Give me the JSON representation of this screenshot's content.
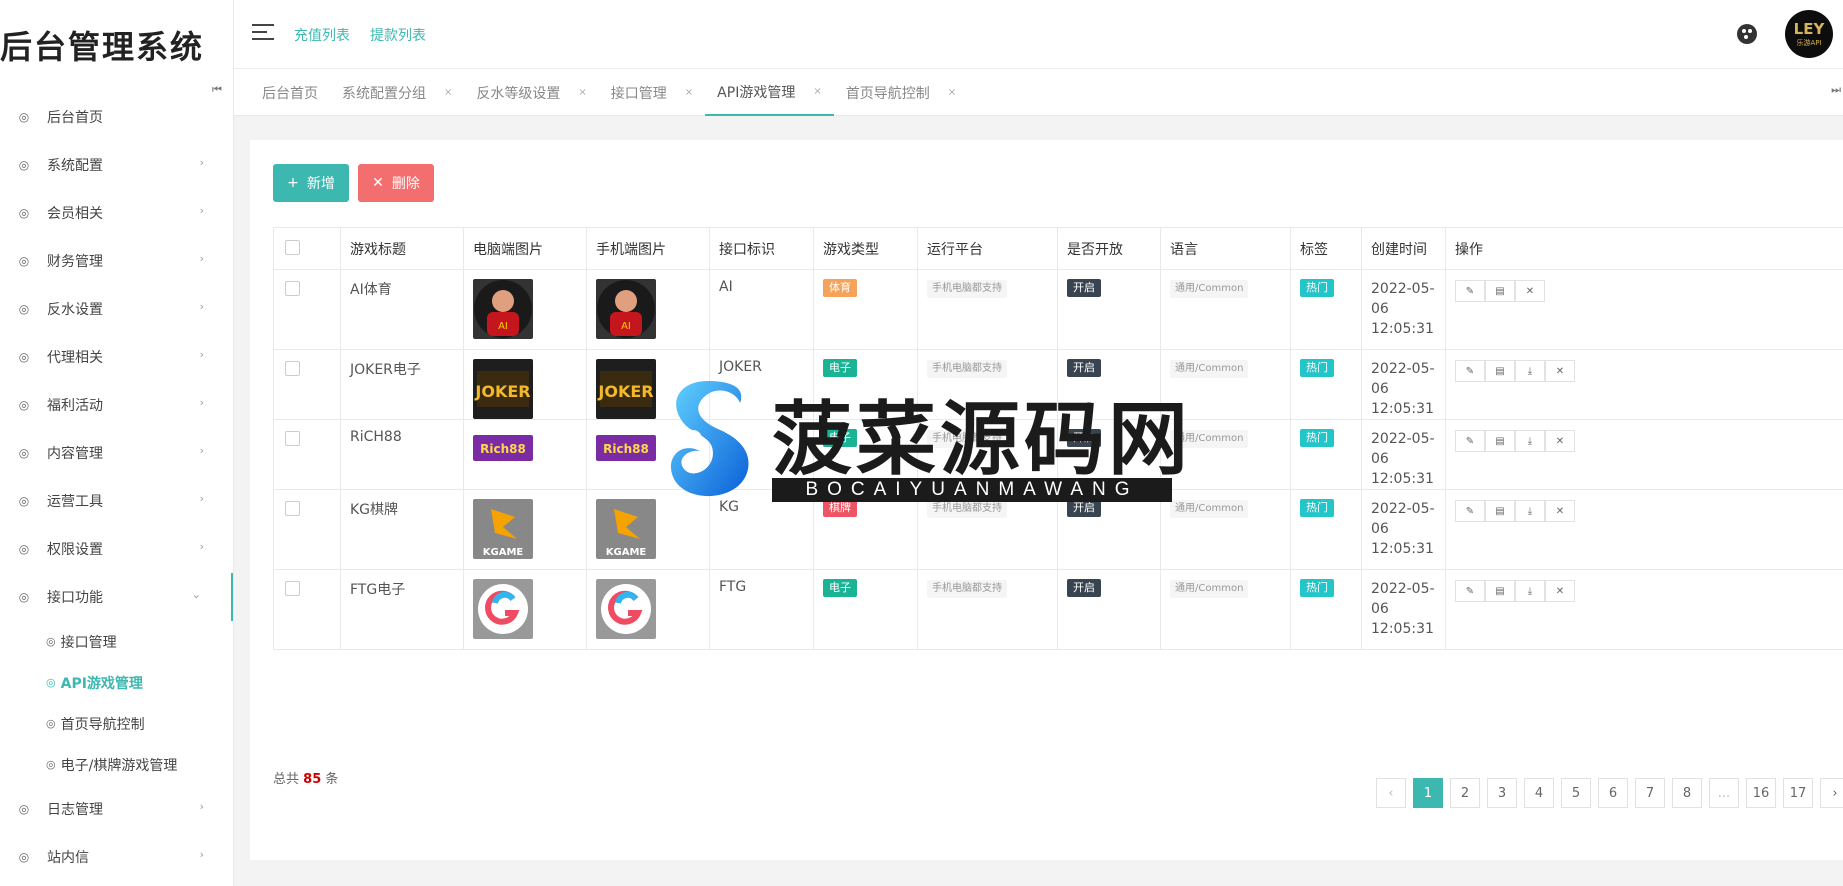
{
  "brand": "后台管理系统",
  "header": {
    "links": [
      "充值列表",
      "提款列表"
    ],
    "avatar_text": "LEY",
    "avatar_sub": "乐游API"
  },
  "sidebar": {
    "items": [
      {
        "label": "后台首页",
        "has_children": false
      },
      {
        "label": "系统配置",
        "has_children": true
      },
      {
        "label": "会员相关",
        "has_children": true
      },
      {
        "label": "财务管理",
        "has_children": true
      },
      {
        "label": "反水设置",
        "has_children": true
      },
      {
        "label": "代理相关",
        "has_children": true
      },
      {
        "label": "福利活动",
        "has_children": true
      },
      {
        "label": "内容管理",
        "has_children": true
      },
      {
        "label": "运营工具",
        "has_children": true
      },
      {
        "label": "权限设置",
        "has_children": true
      },
      {
        "label": "接口功能",
        "has_children": true,
        "open": true
      }
    ],
    "submenu": [
      {
        "label": "接口管理",
        "active": false
      },
      {
        "label": "API游戏管理",
        "active": true
      },
      {
        "label": "首页导航控制",
        "active": false
      },
      {
        "label": "电子/棋牌游戏管理",
        "active": false
      }
    ],
    "after": [
      {
        "label": "日志管理"
      },
      {
        "label": "站内信"
      }
    ]
  },
  "tabs": [
    {
      "label": "后台首页",
      "closable": false,
      "active": false
    },
    {
      "label": "系统配置分组",
      "closable": true,
      "active": false
    },
    {
      "label": "反水等级设置",
      "closable": true,
      "active": false
    },
    {
      "label": "接口管理",
      "closable": true,
      "active": false
    },
    {
      "label": "API游戏管理",
      "closable": true,
      "active": true
    },
    {
      "label": "首页导航控制",
      "closable": true,
      "active": false
    }
  ],
  "toolbar": {
    "add_label": "新增",
    "delete_label": "删除"
  },
  "table": {
    "headers": [
      "游戏标题",
      "电脑端图片",
      "手机端图片",
      "接口标识",
      "游戏类型",
      "运行平台",
      "是否开放",
      "语言",
      "标签",
      "创建时间",
      "操作"
    ],
    "rows": [
      {
        "title": "AI体育",
        "api": "AI",
        "type": "体育",
        "type_color": "#f5a35a",
        "platform": "手机电脑都支持",
        "open": "开启",
        "lang": "通用/Common",
        "tag": "热门",
        "date": "2022-05-06",
        "time": "12:05:31",
        "img": "ai",
        "ops": 3
      },
      {
        "title": "JOKER电子",
        "api": "JOKER",
        "type": "电子",
        "type_color": "#1ab394",
        "platform": "手机电脑都支持",
        "open": "开启",
        "lang": "通用/Common",
        "tag": "热门",
        "date": "2022-05-06",
        "time": "12:05:31",
        "img": "joker",
        "ops": 4
      },
      {
        "title": "RiCH88",
        "api": "",
        "type": "电子",
        "type_color": "#1ab394",
        "platform": "手机电脑都支持",
        "open": "开启",
        "lang": "通用/Common",
        "tag": "热门",
        "date": "2022-05-06",
        "time": "12:05:31",
        "img": "rich",
        "ops": 4
      },
      {
        "title": "KG棋牌",
        "api": "KG",
        "type": "棋牌",
        "type_color": "#ed5565",
        "platform": "手机电脑都支持",
        "open": "开启",
        "lang": "通用/Common",
        "tag": "热门",
        "date": "2022-05-06",
        "time": "12:05:31",
        "img": "kg",
        "ops": 4
      },
      {
        "title": "FTG电子",
        "api": "FTG",
        "type": "电子",
        "type_color": "#1ab394",
        "platform": "手机电脑都支持",
        "open": "开启",
        "lang": "通用/Common",
        "tag": "热门",
        "date": "2022-05-06",
        "time": "12:05:31",
        "img": "ftg",
        "ops": 4
      }
    ]
  },
  "footer": {
    "total_prefix": "总共",
    "total_count": "85",
    "total_suffix": "条"
  },
  "pagination": [
    "‹",
    "1",
    "2",
    "3",
    "4",
    "5",
    "6",
    "7",
    "8",
    "...",
    "16",
    "17",
    "›"
  ],
  "pagination_current": "1",
  "watermark": {
    "title": "菠菜源码网",
    "subtitle": "BOCAIYUANMAWANG"
  }
}
